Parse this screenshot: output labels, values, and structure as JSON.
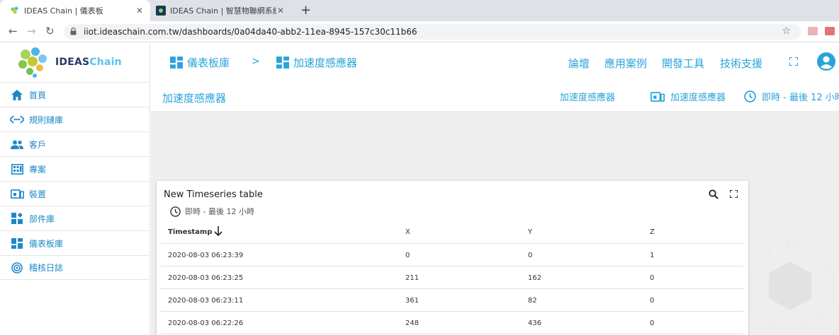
{
  "browser": {
    "tabs": [
      {
        "title": "IDEAS Chain | 儀表板",
        "active": true
      },
      {
        "title": "IDEAS Chain | 智慧物聯網系統 -",
        "active": false
      }
    ],
    "url": "iiot.ideaschain.com.tw/dashboards/0a04da40-abb2-11ea-8945-157c30c11b66"
  },
  "logo": {
    "part1": "IDEAS",
    "part2": "Chain"
  },
  "sidebar": {
    "items": [
      {
        "label": "首頁",
        "icon": "home-icon"
      },
      {
        "label": "規則鏈庫",
        "icon": "rule-chain-icon"
      },
      {
        "label": "客戶",
        "icon": "customers-icon"
      },
      {
        "label": "專案",
        "icon": "project-icon"
      },
      {
        "label": "裝置",
        "icon": "device-icon"
      },
      {
        "label": "部件庫",
        "icon": "widgets-icon"
      },
      {
        "label": "儀表板庫",
        "icon": "dashboard-icon"
      },
      {
        "label": "稽核日誌",
        "icon": "audit-log-icon"
      }
    ]
  },
  "header": {
    "breadcrumb": [
      {
        "label": "儀表板庫"
      },
      {
        "label": "加速度感應器"
      }
    ],
    "breadcrumb_sep": ">",
    "nav": [
      "論壇",
      "應用案例",
      "開發工具",
      "技術支援"
    ],
    "subtitle": "加速度感應器",
    "sub_entity_alias": "加速度感應器",
    "sub_device": "加速度感應器",
    "sub_timewindow": "即時 - 最後 12 小時"
  },
  "widget": {
    "title": "New Timeseries table",
    "timewindow": "即時 - 最後 12 小時",
    "columns": [
      "Timestamp",
      "X",
      "Y",
      "Z"
    ],
    "rows": [
      [
        "2020-08-03 06:23:39",
        "0",
        "0",
        "1"
      ],
      [
        "2020-08-03 06:23:25",
        "211",
        "162",
        "0"
      ],
      [
        "2020-08-03 06:23:11",
        "361",
        "82",
        "0"
      ],
      [
        "2020-08-03 06:22:26",
        "248",
        "436",
        "0"
      ]
    ]
  },
  "colors": {
    "accent": "#29a3da",
    "sidebar_text": "#1e88c8",
    "canvas": "#eeeeee"
  }
}
